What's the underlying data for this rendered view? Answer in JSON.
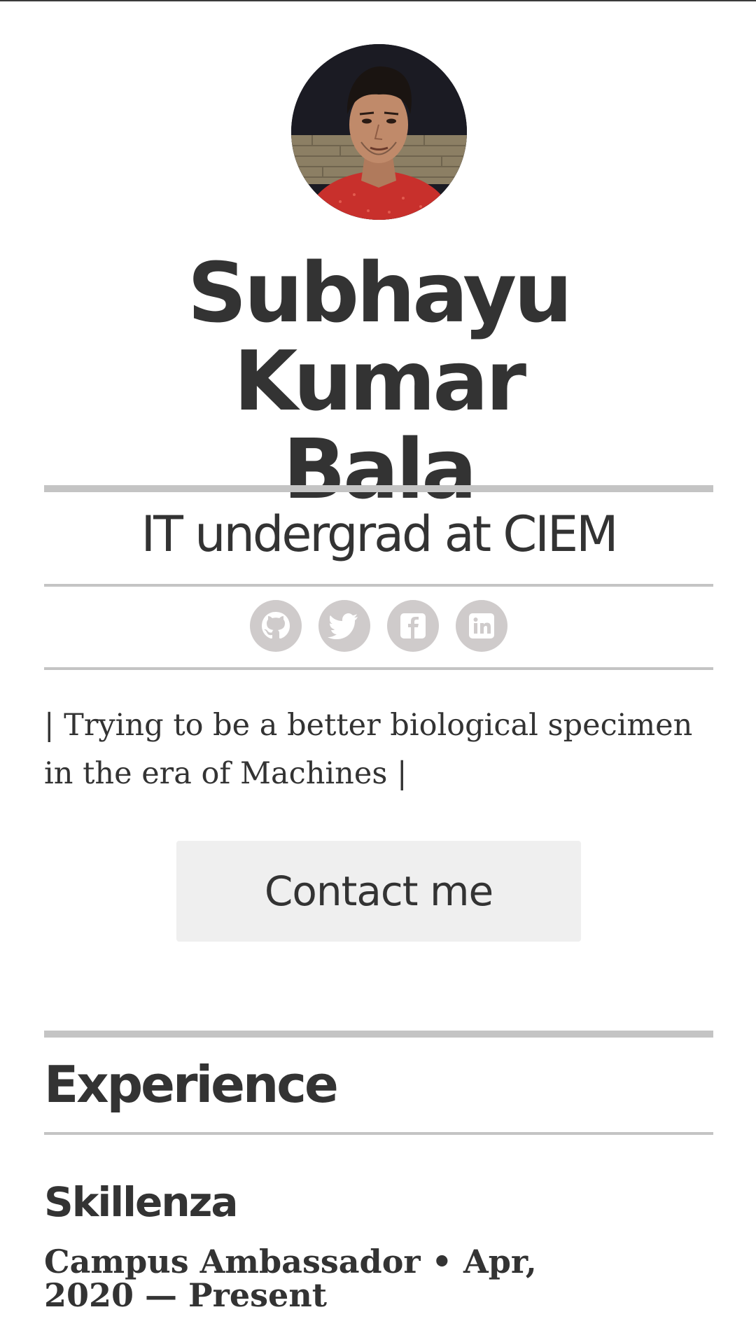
{
  "profile": {
    "avatar_icon": "profile-photo",
    "name_line1": "Subhayu Kumar",
    "name_line2": "Bala",
    "tagline": "IT undergrad at CIEM",
    "bio": "| Trying to be a better biological specimen in the era of Machines |"
  },
  "socials": [
    {
      "icon": "github-icon",
      "label": "GitHub"
    },
    {
      "icon": "twitter-icon",
      "label": "Twitter"
    },
    {
      "icon": "facebook-icon",
      "label": "Facebook"
    },
    {
      "icon": "linkedin-icon",
      "label": "LinkedIn"
    }
  ],
  "contact": {
    "label": "Contact me"
  },
  "experience": {
    "heading": "Experience",
    "items": [
      {
        "company": "Skillenza",
        "role_line": "Campus Ambassador • Apr, 2020 — Present"
      }
    ]
  },
  "colors": {
    "text": "#333333",
    "rule": "#c4c4c4",
    "social_bg": "#cfcbcb",
    "button_bg": "#efefef"
  }
}
